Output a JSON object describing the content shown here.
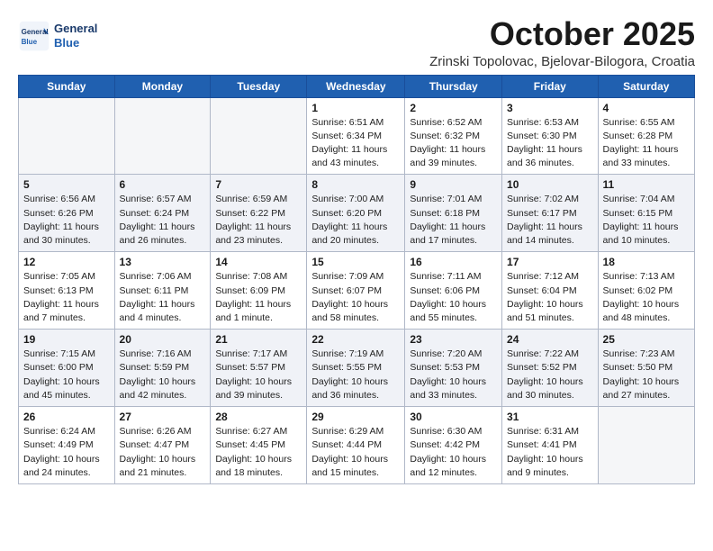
{
  "header": {
    "logo_line1": "General",
    "logo_line2": "Blue",
    "month": "October 2025",
    "location": "Zrinski Topolovac, Bjelovar-Bilogora, Croatia"
  },
  "days_of_week": [
    "Sunday",
    "Monday",
    "Tuesday",
    "Wednesday",
    "Thursday",
    "Friday",
    "Saturday"
  ],
  "weeks": [
    [
      {
        "day": "",
        "info": ""
      },
      {
        "day": "",
        "info": ""
      },
      {
        "day": "",
        "info": ""
      },
      {
        "day": "1",
        "info": "Sunrise: 6:51 AM\nSunset: 6:34 PM\nDaylight: 11 hours\nand 43 minutes."
      },
      {
        "day": "2",
        "info": "Sunrise: 6:52 AM\nSunset: 6:32 PM\nDaylight: 11 hours\nand 39 minutes."
      },
      {
        "day": "3",
        "info": "Sunrise: 6:53 AM\nSunset: 6:30 PM\nDaylight: 11 hours\nand 36 minutes."
      },
      {
        "day": "4",
        "info": "Sunrise: 6:55 AM\nSunset: 6:28 PM\nDaylight: 11 hours\nand 33 minutes."
      }
    ],
    [
      {
        "day": "5",
        "info": "Sunrise: 6:56 AM\nSunset: 6:26 PM\nDaylight: 11 hours\nand 30 minutes."
      },
      {
        "day": "6",
        "info": "Sunrise: 6:57 AM\nSunset: 6:24 PM\nDaylight: 11 hours\nand 26 minutes."
      },
      {
        "day": "7",
        "info": "Sunrise: 6:59 AM\nSunset: 6:22 PM\nDaylight: 11 hours\nand 23 minutes."
      },
      {
        "day": "8",
        "info": "Sunrise: 7:00 AM\nSunset: 6:20 PM\nDaylight: 11 hours\nand 20 minutes."
      },
      {
        "day": "9",
        "info": "Sunrise: 7:01 AM\nSunset: 6:18 PM\nDaylight: 11 hours\nand 17 minutes."
      },
      {
        "day": "10",
        "info": "Sunrise: 7:02 AM\nSunset: 6:17 PM\nDaylight: 11 hours\nand 14 minutes."
      },
      {
        "day": "11",
        "info": "Sunrise: 7:04 AM\nSunset: 6:15 PM\nDaylight: 11 hours\nand 10 minutes."
      }
    ],
    [
      {
        "day": "12",
        "info": "Sunrise: 7:05 AM\nSunset: 6:13 PM\nDaylight: 11 hours\nand 7 minutes."
      },
      {
        "day": "13",
        "info": "Sunrise: 7:06 AM\nSunset: 6:11 PM\nDaylight: 11 hours\nand 4 minutes."
      },
      {
        "day": "14",
        "info": "Sunrise: 7:08 AM\nSunset: 6:09 PM\nDaylight: 11 hours\nand 1 minute."
      },
      {
        "day": "15",
        "info": "Sunrise: 7:09 AM\nSunset: 6:07 PM\nDaylight: 10 hours\nand 58 minutes."
      },
      {
        "day": "16",
        "info": "Sunrise: 7:11 AM\nSunset: 6:06 PM\nDaylight: 10 hours\nand 55 minutes."
      },
      {
        "day": "17",
        "info": "Sunrise: 7:12 AM\nSunset: 6:04 PM\nDaylight: 10 hours\nand 51 minutes."
      },
      {
        "day": "18",
        "info": "Sunrise: 7:13 AM\nSunset: 6:02 PM\nDaylight: 10 hours\nand 48 minutes."
      }
    ],
    [
      {
        "day": "19",
        "info": "Sunrise: 7:15 AM\nSunset: 6:00 PM\nDaylight: 10 hours\nand 45 minutes."
      },
      {
        "day": "20",
        "info": "Sunrise: 7:16 AM\nSunset: 5:59 PM\nDaylight: 10 hours\nand 42 minutes."
      },
      {
        "day": "21",
        "info": "Sunrise: 7:17 AM\nSunset: 5:57 PM\nDaylight: 10 hours\nand 39 minutes."
      },
      {
        "day": "22",
        "info": "Sunrise: 7:19 AM\nSunset: 5:55 PM\nDaylight: 10 hours\nand 36 minutes."
      },
      {
        "day": "23",
        "info": "Sunrise: 7:20 AM\nSunset: 5:53 PM\nDaylight: 10 hours\nand 33 minutes."
      },
      {
        "day": "24",
        "info": "Sunrise: 7:22 AM\nSunset: 5:52 PM\nDaylight: 10 hours\nand 30 minutes."
      },
      {
        "day": "25",
        "info": "Sunrise: 7:23 AM\nSunset: 5:50 PM\nDaylight: 10 hours\nand 27 minutes."
      }
    ],
    [
      {
        "day": "26",
        "info": "Sunrise: 6:24 AM\nSunset: 4:49 PM\nDaylight: 10 hours\nand 24 minutes."
      },
      {
        "day": "27",
        "info": "Sunrise: 6:26 AM\nSunset: 4:47 PM\nDaylight: 10 hours\nand 21 minutes."
      },
      {
        "day": "28",
        "info": "Sunrise: 6:27 AM\nSunset: 4:45 PM\nDaylight: 10 hours\nand 18 minutes."
      },
      {
        "day": "29",
        "info": "Sunrise: 6:29 AM\nSunset: 4:44 PM\nDaylight: 10 hours\nand 15 minutes."
      },
      {
        "day": "30",
        "info": "Sunrise: 6:30 AM\nSunset: 4:42 PM\nDaylight: 10 hours\nand 12 minutes."
      },
      {
        "day": "31",
        "info": "Sunrise: 6:31 AM\nSunset: 4:41 PM\nDaylight: 10 hours\nand 9 minutes."
      },
      {
        "day": "",
        "info": ""
      }
    ]
  ]
}
